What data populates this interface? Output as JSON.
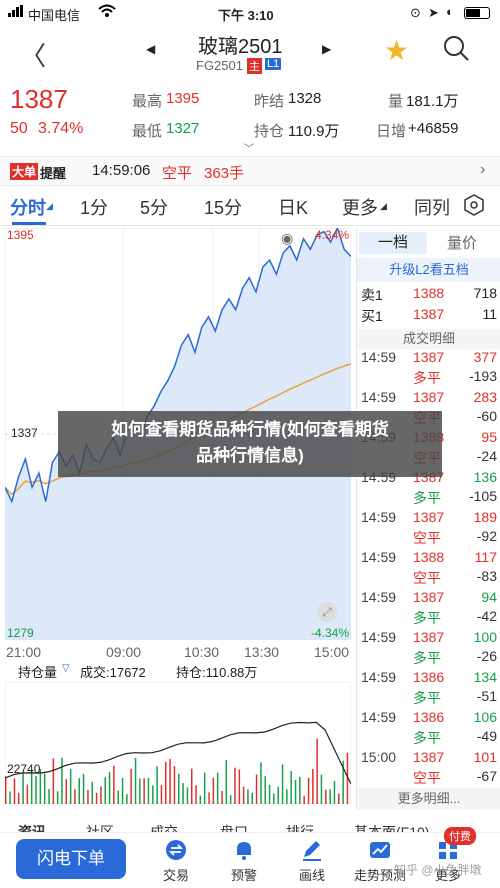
{
  "status": {
    "carrier": "中国电信",
    "time": "下午 3:10"
  },
  "header": {
    "title": "玻璃2501",
    "code": "FG2501",
    "badge_main": "主",
    "badge_l1": "L1"
  },
  "quote": {
    "price": "1387",
    "change": "50",
    "change_pct": "3.74%",
    "high_label": "最高",
    "high": "1395",
    "low_label": "最低",
    "low": "1327",
    "prev_label": "昨结",
    "prev": "1328",
    "oi_label": "持仓",
    "oi": "110.9万",
    "vol_label": "量",
    "vol": "181.1万",
    "daily_label": "日增",
    "daily": "+46859"
  },
  "alert": {
    "tag1": "大单",
    "tag2": "提醒",
    "time": "14:59:06",
    "type": "空平",
    "qty": "363手"
  },
  "tabs": [
    "分时",
    "1分",
    "5分",
    "15分",
    "日K",
    "更多",
    "同列"
  ],
  "chart": {
    "price_top": "1395",
    "pct_top": "4.34%",
    "price_bottom": "1279",
    "pct_bottom": "-4.34%",
    "mid_price": "1337",
    "time_labels": [
      "21:00",
      "09:00",
      "10:30",
      "13:30",
      "15:00"
    ],
    "accent": "#2a6ad8",
    "avg_color": "#e8a23a",
    "fill_color": "#cfe0f7",
    "price_series": [
      1322,
      1318,
      1325,
      1330,
      1322,
      1326,
      1318,
      1329,
      1332,
      1328,
      1331,
      1326,
      1334,
      1330,
      1329,
      1333,
      1336,
      1331,
      1338,
      1340,
      1336,
      1342,
      1345,
      1349,
      1352,
      1356,
      1362,
      1365,
      1360,
      1367,
      1370,
      1366,
      1372,
      1375,
      1372,
      1378,
      1381,
      1377,
      1384,
      1386,
      1382,
      1388,
      1390,
      1386,
      1392,
      1389,
      1393,
      1394,
      1391,
      1395,
      1389,
      1387
    ]
  },
  "vol_header": {
    "select": "持仓量",
    "vol": "成交:17672",
    "oi": "持仓:110.88万",
    "vol_axis": "22740"
  },
  "panel": {
    "tab1": "一档",
    "tab2": "量价",
    "upgrade": "升级L2看五档",
    "ask_label": "卖1",
    "ask_price": "1388",
    "ask_qty": "718",
    "bid_label": "买1",
    "bid_price": "1387",
    "bid_qty": "11",
    "ticks_header": "成交明细",
    "ticks": [
      {
        "time": "14:59",
        "price": "1387",
        "qty": "377",
        "type": "多平",
        "chg": "-193",
        "up": false
      },
      {
        "time": "14:59",
        "price": "1387",
        "qty": "283",
        "type": "空平",
        "chg": "-60",
        "up": false
      },
      {
        "time": "14:59",
        "price": "1388",
        "qty": "95",
        "type": "空平",
        "chg": "-24",
        "up": false
      },
      {
        "time": "14:59",
        "price": "1387",
        "qty": "136",
        "type": "多平",
        "chg": "-105",
        "up": true
      },
      {
        "time": "14:59",
        "price": "1387",
        "qty": "189",
        "type": "空平",
        "chg": "-92",
        "up": false
      },
      {
        "time": "14:59",
        "price": "1388",
        "qty": "117",
        "type": "空平",
        "chg": "-83",
        "up": false
      },
      {
        "time": "14:59",
        "price": "1387",
        "qty": "94",
        "type": "多平",
        "chg": "-42",
        "up": true
      },
      {
        "time": "14:59",
        "price": "1387",
        "qty": "100",
        "type": "多平",
        "chg": "-26",
        "up": true
      },
      {
        "time": "14:59",
        "price": "1386",
        "qty": "134",
        "type": "多平",
        "chg": "-51",
        "up": true
      },
      {
        "time": "14:59",
        "price": "1386",
        "qty": "106",
        "type": "多平",
        "chg": "-49",
        "up": true
      },
      {
        "time": "15:00",
        "price": "1387",
        "qty": "101",
        "type": "空平",
        "chg": "-67",
        "up": false
      }
    ],
    "more": "更多明细..."
  },
  "bottom_tabs": [
    "资讯",
    "社区",
    "成交",
    "盘口",
    "排行",
    "基本面(F10)"
  ],
  "nav": {
    "flash": "闪电下单",
    "items": [
      "交易",
      "预警",
      "画线",
      "走势预测",
      "更多"
    ],
    "paid": "付费"
  },
  "banner": {
    "line1": "如何查看期货品种行情(如何查看期货",
    "line2": "品种行情信息)"
  },
  "watermark": "知乎 @小兔胖墩"
}
